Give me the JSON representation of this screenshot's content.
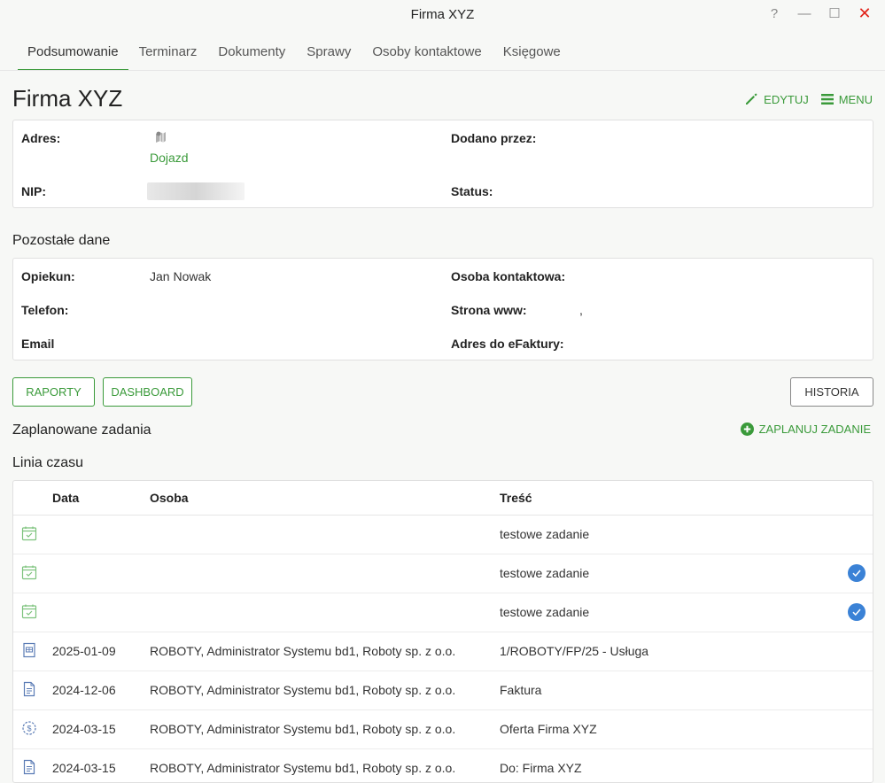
{
  "window": {
    "title": "Firma XYZ",
    "help": "?",
    "minimize": "—",
    "maximize": "☐",
    "close": "✕"
  },
  "tabs": [
    {
      "label": "Podsumowanie"
    },
    {
      "label": "Terminarz"
    },
    {
      "label": "Dokumenty"
    },
    {
      "label": "Sprawy"
    },
    {
      "label": "Osoby kontaktowe"
    },
    {
      "label": "Księgowe"
    }
  ],
  "header": {
    "title": "Firma XYZ",
    "edit_label": "EDYTUJ",
    "menu_label": "MENU"
  },
  "basic": {
    "address_label": "Adres:",
    "route_link": "Dojazd",
    "nip_label": "NIP:",
    "added_by_label": "Dodano przez:",
    "status_label": "Status:"
  },
  "other": {
    "title": "Pozostałe dane",
    "guardian_label": "Opiekun:",
    "guardian_value": "Jan Nowak",
    "phone_label": "Telefon:",
    "email_label": "Email",
    "contact_label": "Osoba kontaktowa:",
    "www_label": "Strona www:",
    "www_value": ",",
    "einvoice_label": "Adres do eFaktury:"
  },
  "buttons": {
    "reports": "RAPORTY",
    "dashboard": "DASHBOARD",
    "history": "HISTORIA"
  },
  "planned": {
    "title": "Zaplanowane zadania",
    "add_label": "ZAPLANUJ ZADANIE"
  },
  "timeline": {
    "title": "Linia czasu",
    "columns": {
      "date": "Data",
      "person": "Osoba",
      "content": "Treść"
    },
    "rows": [
      {
        "icon": "calendar-check-icon",
        "date": "",
        "person": "",
        "content": "testowe zadanie",
        "done": false
      },
      {
        "icon": "calendar-check-icon",
        "date": "",
        "person": "",
        "content": "testowe zadanie",
        "done": true
      },
      {
        "icon": "calendar-check-icon",
        "date": "",
        "person": "",
        "content": "testowe zadanie",
        "done": true
      },
      {
        "icon": "invoice-icon",
        "date": "2025-01-09",
        "person": "ROBOTY, Administrator Systemu bd1, Roboty sp. z o.o.",
        "content": "1/ROBOTY/FP/25 - Usługa",
        "done": false
      },
      {
        "icon": "document-icon",
        "date": "2024-12-06",
        "person": "ROBOTY, Administrator Systemu bd1, Roboty sp. z o.o.",
        "content": "Faktura",
        "done": false
      },
      {
        "icon": "offer-icon",
        "date": "2024-03-15",
        "person": "ROBOTY, Administrator Systemu bd1, Roboty sp. z o.o.",
        "content": "Oferta Firma XYZ",
        "done": false
      },
      {
        "icon": "document-icon",
        "date": "2024-03-15",
        "person": "ROBOTY, Administrator Systemu bd1, Roboty sp. z o.o.",
        "content": "Do: Firma XYZ",
        "done": false
      }
    ]
  },
  "colors": {
    "accent": "#3a9a3a",
    "check": "#3b82d6",
    "close": "#e2231a"
  }
}
